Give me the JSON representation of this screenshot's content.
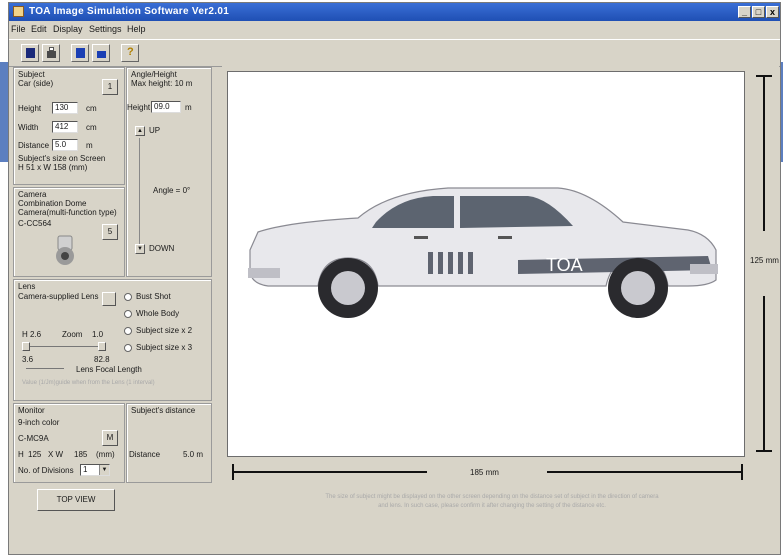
{
  "window": {
    "title": "TOA Image Simulation Software Ver2.01",
    "minimize": "_",
    "maximize": "□",
    "close": "x"
  },
  "menu": [
    "File",
    "Edit",
    "Display",
    "Settings",
    "Help"
  ],
  "subject": {
    "group_label": "Subject",
    "name": "Car (side)",
    "select_button": "1",
    "height_label": "Height",
    "height_value": "130",
    "height_unit": "cm",
    "width_label": "Width",
    "width_value": "412",
    "width_unit": "cm",
    "distance_label": "Distance",
    "distance_value": "5.0",
    "distance_unit": "m",
    "size_label": "Subject's size on Screen",
    "size_value": "H 51 x W 158 (mm)"
  },
  "angle": {
    "group_label": "Angle/Height",
    "max_height": "Max height: 10 m",
    "height_label": "Height",
    "height_value": "09.0",
    "height_unit": "m",
    "up_label": "UP",
    "angle_label": "Angle = 0°",
    "down_label": "DOWN",
    "up_button": "▲",
    "down_button": "▼"
  },
  "camera": {
    "group_label": "Camera",
    "type": "Combination Dome Camera(multi-function type)",
    "model": "C-CC564",
    "select_button": "5"
  },
  "lens": {
    "group_label": "Lens",
    "lens_name": "Camera-supplied Lens",
    "radios": [
      "Bust Shot",
      "Whole Body",
      "Subject size x 2",
      "Subject size x 3"
    ],
    "h_label": "H 2.6",
    "zoom_label": "Zoom",
    "zoom_value": "1.0",
    "min_focal": "3.6",
    "max_focal": "82.8",
    "focal_label": "Lens Focal Length",
    "note": "Value (1/Jm)guide when from the Lens (1 interval)"
  },
  "monitor": {
    "group_label": "Monitor",
    "type": "9-inch color",
    "model": "C-MC9A",
    "select_button": "M",
    "h_label": "H",
    "h_value": "125",
    "w_label": "X W",
    "w_value": "185",
    "unit": "(mm)",
    "divisions_label": "No. of Divisions",
    "divisions_value": "1"
  },
  "distance_panel": {
    "group_label": "Subject's distance",
    "distance_label": "Distance",
    "distance_value": "5.0 m"
  },
  "top_view_button": "TOP VIEW",
  "canvas": {
    "width_dim": "185 mm",
    "height_dim": "125 mm",
    "car_brand": "TOA",
    "note_line1": "The size of subject might be displayed on the other screen depending on the distance set of subject in the direction of camera",
    "note_line2": "and lens. In such case, please confirm it after changing the setting of the distance etc."
  },
  "colors": {
    "window_bg": "#d8d4c8",
    "titlebar": "#1f4fb4",
    "backdrop": "#5c7fc0",
    "car_body": "#e8e8ec",
    "car_stripe": "#5f6470"
  }
}
